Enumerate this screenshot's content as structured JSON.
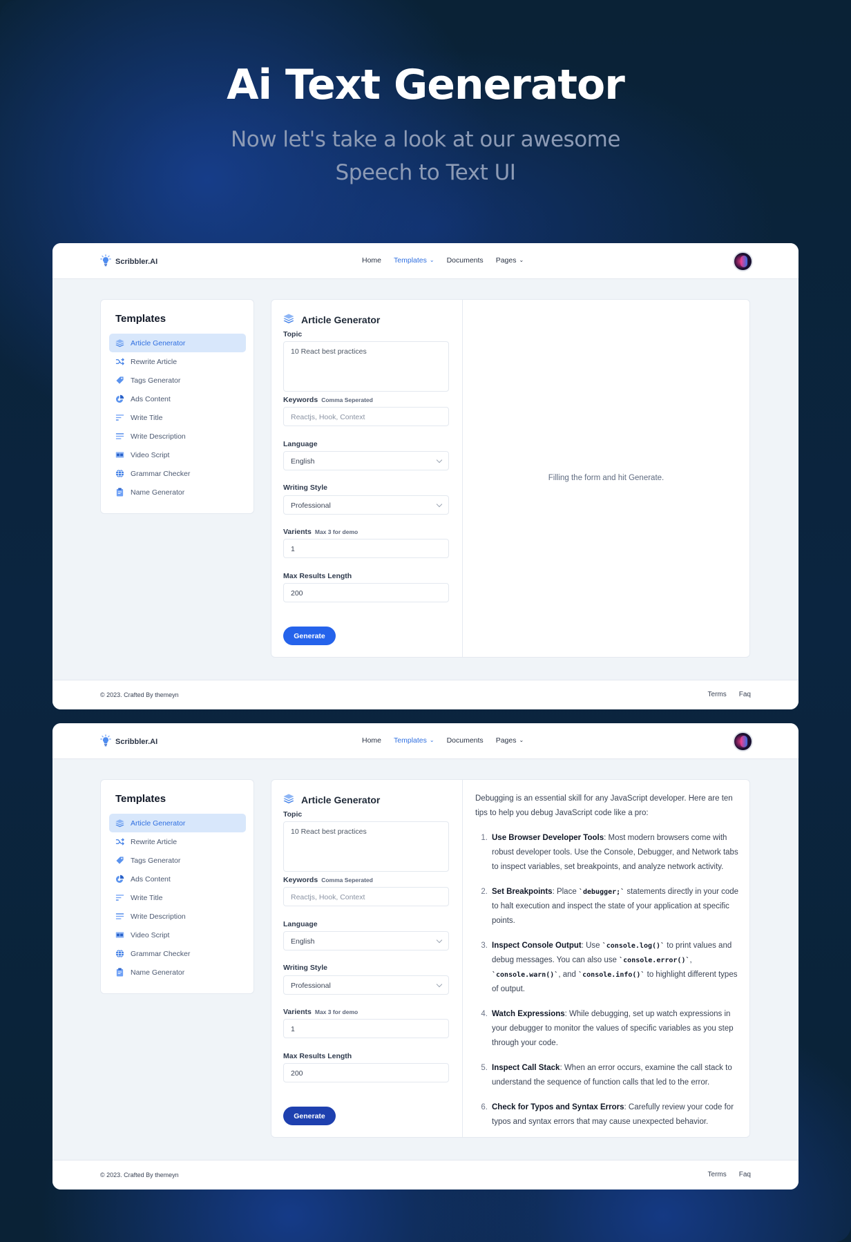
{
  "hero": {
    "title": "Ai Text Generator",
    "subtitle_line1": "Now let's take a look at our awesome",
    "subtitle_line2": "Speech to Text UI"
  },
  "colors": {
    "accent": "#2563eb",
    "accent_pressed": "#1e40af",
    "active_bg": "#d8e7fb",
    "body_bg": "#f0f4f8",
    "page_bg": "#0a2236"
  },
  "app": {
    "brand": "Scribbler.AI",
    "brand_icon": "lightbulb-icon",
    "nav": [
      {
        "label": "Home",
        "active": false,
        "dropdown": false
      },
      {
        "label": "Templates",
        "active": true,
        "dropdown": true
      },
      {
        "label": "Documents",
        "active": false,
        "dropdown": false
      },
      {
        "label": "Pages",
        "active": false,
        "dropdown": true
      }
    ],
    "avatar": "user-avatar",
    "footer": {
      "copyright": "© 2023. Crafted By themeyn",
      "links": [
        "Terms",
        "Faq"
      ]
    },
    "sidebar": {
      "title": "Templates",
      "items": [
        {
          "label": "Article Generator",
          "icon": "layers-icon",
          "active": true
        },
        {
          "label": "Rewrite Article",
          "icon": "shuffle-icon",
          "active": false
        },
        {
          "label": "Tags Generator",
          "icon": "tag-icon",
          "active": false
        },
        {
          "label": "Ads Content",
          "icon": "pie-chart-icon",
          "active": false
        },
        {
          "label": "Write Title",
          "icon": "align-left-icon",
          "active": false
        },
        {
          "label": "Write Description",
          "icon": "text-lines-icon",
          "active": false
        },
        {
          "label": "Video Script",
          "icon": "film-icon",
          "active": false
        },
        {
          "label": "Grammar Checker",
          "icon": "globe-icon",
          "active": false
        },
        {
          "label": "Name Generator",
          "icon": "clipboard-icon",
          "active": false
        }
      ]
    },
    "form": {
      "title": "Article Generator",
      "topic_label": "Topic",
      "topic_value": "10 React best practices",
      "keywords_label": "Keywords",
      "keywords_hint": "Comma Seperated",
      "keywords_placeholder": "Reactjs, Hook, Context",
      "language_label": "Language",
      "language_value": "English",
      "style_label": "Writing Style",
      "style_value": "Professional",
      "variants_label": "Varients",
      "variants_hint": "Max 3 for demo",
      "variants_value": "1",
      "max_length_label": "Max Results Length",
      "max_length_value": "200",
      "generate_label": "Generate"
    }
  },
  "screen1": {
    "empty_message": "Filling the form and hit Generate."
  },
  "screen2": {
    "intro": "Debugging is an essential skill for any JavaScript developer. Here are ten tips to help you debug JavaScript code like a pro:",
    "tips": [
      {
        "num": "1.",
        "title": "Use Browser Developer Tools",
        "parts": [
          {
            "t": ": Most modern browsers come with robust developer tools. Use the Console, Debugger, and Network tabs to inspect variables, set breakpoints, and analyze network activity."
          }
        ]
      },
      {
        "num": "2.",
        "title": "Set Breakpoints",
        "parts": [
          {
            "t": ": Place "
          },
          {
            "c": "`debugger;`"
          },
          {
            "t": " statements directly in your code to halt execution and inspect the state of your application at specific points."
          }
        ]
      },
      {
        "num": "3.",
        "title": "Inspect Console Output",
        "parts": [
          {
            "t": ": Use "
          },
          {
            "c": "`console.log()`"
          },
          {
            "t": " to print values and debug messages. You can also use "
          },
          {
            "c": "`console.error()`"
          },
          {
            "t": ", "
          },
          {
            "c": "`console.warn()`"
          },
          {
            "t": ", and "
          },
          {
            "c": "`console.info()`"
          },
          {
            "t": " to highlight different types of output."
          }
        ]
      },
      {
        "num": "4.",
        "title": "Watch Expressions",
        "parts": [
          {
            "t": ": While debugging, set up watch expressions in your debugger to monitor the values of specific variables as you step through your code."
          }
        ]
      },
      {
        "num": "5.",
        "title": "Inspect Call Stack",
        "parts": [
          {
            "t": ": When an error occurs, examine the call stack to understand the sequence of function calls that led to the error."
          }
        ]
      },
      {
        "num": "6.",
        "title": "Check for Typos and Syntax Errors",
        "parts": [
          {
            "t": ": Carefully review your code for typos and syntax errors that may cause unexpected behavior."
          }
        ]
      }
    ]
  }
}
